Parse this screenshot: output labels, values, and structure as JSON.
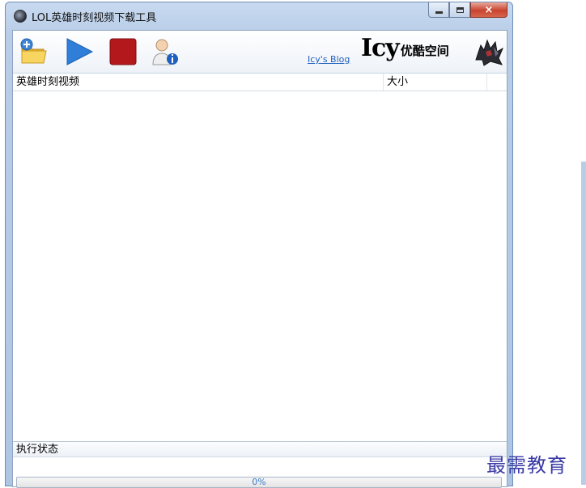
{
  "window": {
    "title": "LOL英雄时刻视频下载工具"
  },
  "titlebar_buttons": {
    "minimize": "minimize",
    "maximize": "maximize",
    "close": "×"
  },
  "toolbar": {
    "buttons": [
      {
        "name": "add-task-button",
        "icon": "folder-add-icon"
      },
      {
        "name": "start-button",
        "icon": "play-icon"
      },
      {
        "name": "stop-button",
        "icon": "stop-icon"
      },
      {
        "name": "about-button",
        "icon": "user-info-icon"
      }
    ],
    "blog_link": "Icy's Blog",
    "brand_big": "Icy",
    "brand_small": "优酷空间"
  },
  "list": {
    "columns": [
      "英雄时刻视频",
      "大小"
    ],
    "rows": []
  },
  "status": {
    "label": "执行状态",
    "progress_percent": 0,
    "progress_text": "0%"
  },
  "watermark": "最需教育",
  "colors": {
    "accent": "#2f7ed8",
    "stop_red": "#b3191c",
    "link": "#1f5fbf",
    "progress_text": "#3b78c8"
  }
}
